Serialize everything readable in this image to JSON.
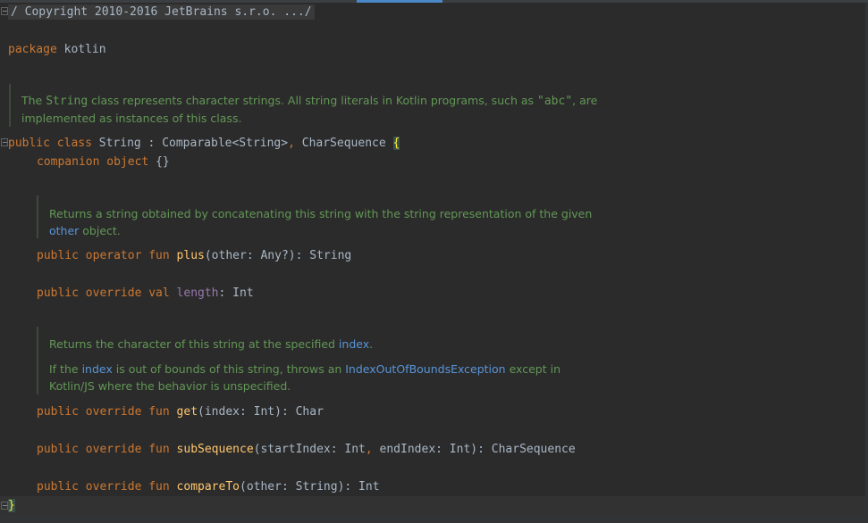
{
  "editor": {
    "copyright_fold": "/ Copyright 2010-2016 JetBrains s.r.o. .../",
    "package": {
      "keyword": "package",
      "name": "kotlin"
    },
    "class_doc": {
      "t1": "The ",
      "code1": "String",
      "t2": " class represents character strings. All string literals in Kotlin programs, such as ",
      "code2": "\"abc\"",
      "t3": ", are",
      "line2": "implemented as instances of this class."
    },
    "class_decl": {
      "public": "public",
      "class": "class",
      "name": " String : Comparable<String>",
      "comma": ",",
      "rest": " CharSequence ",
      "brace": "{"
    },
    "companion": {
      "kw1": "companion",
      "kw2": "object",
      "rest": " {}"
    },
    "plus_doc": {
      "line1": "Returns a string obtained by concatenating this string with the string representation of the given",
      "link": "other",
      "line2_rest": " object."
    },
    "plus_decl": {
      "mods": "public operator fun",
      "name": "plus",
      "sig": "(other: Any?): String"
    },
    "length_decl": {
      "mods": "public override val",
      "name": "length",
      "sig": ": Int"
    },
    "get_doc": {
      "p1": "Returns the character of this string at the specified ",
      "p1_link": "index",
      "p1_end": ".",
      "p2a": "If the ",
      "p2_link1": "index",
      "p2b": " is out of bounds of this string, throws an ",
      "p2_link2": "IndexOutOfBoundsException",
      "p2c": " except in",
      "p2_line2": "Kotlin/JS where the behavior is unspecified."
    },
    "get_decl": {
      "mods": "public override fun",
      "name": "get",
      "sig": "(index: Int): Char"
    },
    "subseq_decl": {
      "mods": "public override fun",
      "name": "subSequence",
      "sig1": "(startIndex: Int",
      "comma": ",",
      "sig2": " endIndex: Int): CharSequence"
    },
    "compare_decl": {
      "mods": "public override fun",
      "name": "compareTo",
      "sig": "(other: String): Int"
    },
    "closing_brace": "}"
  },
  "colors": {
    "background": "#2b2b2b",
    "keyword": "#cc7832",
    "function": "#ffc66d",
    "property": "#9876aa",
    "text": "#a9b7c6",
    "doc": "#629755",
    "doc_link": "#5894d8"
  }
}
